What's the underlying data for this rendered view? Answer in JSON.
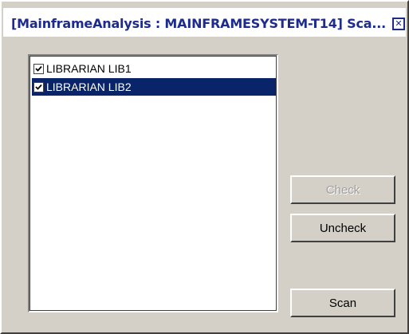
{
  "window": {
    "title": "[MainframeAnalysis : MAINFRAMESYSTEM-T14] Sca...",
    "close_symbol": "✕"
  },
  "list": {
    "items": [
      {
        "label": "LIBRARIAN LIB1",
        "checked": true,
        "selected": false
      },
      {
        "label": "LIBRARIAN LIB2",
        "checked": true,
        "selected": true
      }
    ]
  },
  "buttons": {
    "check_label": "Check",
    "check_enabled": false,
    "uncheck_label": "Uncheck",
    "scan_label": "Scan"
  },
  "colors": {
    "selection": "#0a246a",
    "face": "#d4d0c8",
    "title_text": "#1d2b8f"
  }
}
